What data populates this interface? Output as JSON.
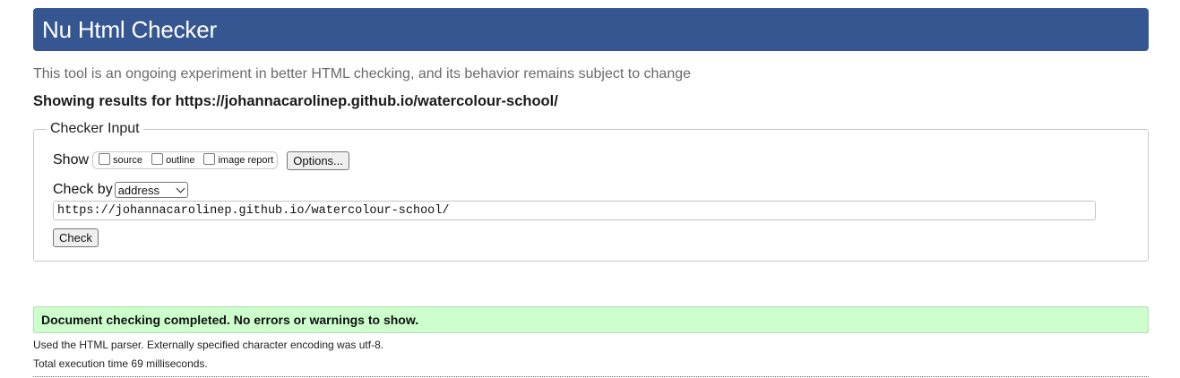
{
  "header": {
    "title": "Nu Html Checker"
  },
  "tagline": "This tool is an ongoing experiment in better HTML checking, and its behavior remains subject to change",
  "showing_results": "Showing results for https://johannacarolinep.github.io/watercolour-school/",
  "checker_input": {
    "legend": "Checker Input",
    "show_label": "Show",
    "show_options": [
      {
        "label": "source",
        "checked": false
      },
      {
        "label": "outline",
        "checked": false
      },
      {
        "label": "image report",
        "checked": false
      }
    ],
    "options_button": "Options...",
    "check_by_label": "Check by",
    "check_by_selected": "address",
    "url_value": "https://johannacarolinep.github.io/watercolour-school/",
    "check_button": "Check"
  },
  "result": {
    "message": "Document checking completed. No errors or warnings to show.",
    "color": "#ccffcc"
  },
  "details": {
    "parser_note": "Used the HTML parser. Externally specified character encoding was utf-8.",
    "execution_time": "Total execution time 69 milliseconds."
  },
  "colors": {
    "header_bg": "#365691"
  }
}
